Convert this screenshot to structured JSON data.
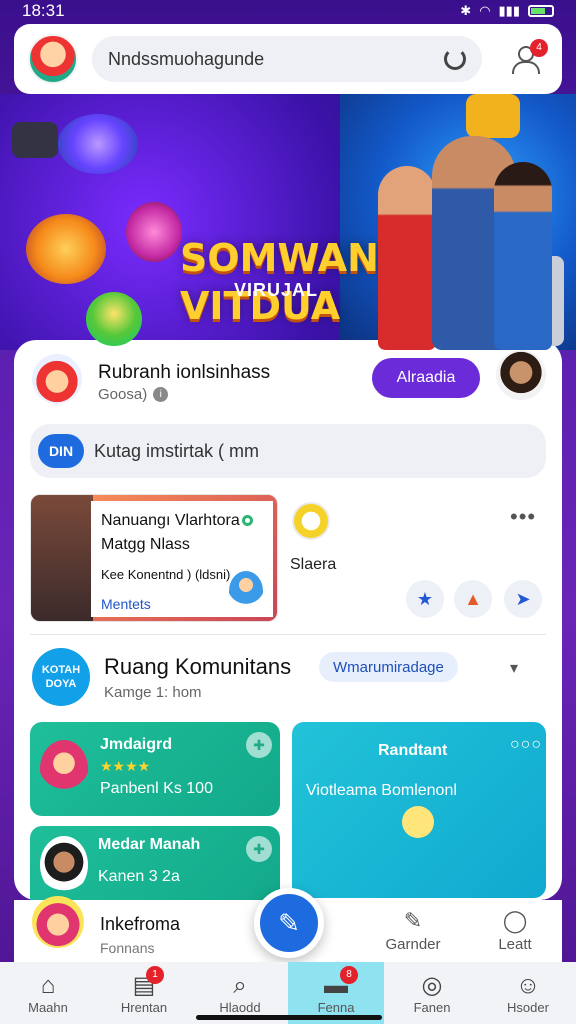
{
  "status": {
    "time": "18:31"
  },
  "header": {
    "search_text": "Nndssmuohagundе"
  },
  "notifications": {
    "count": "4"
  },
  "banner": {
    "title_line1": "SOMWAN",
    "title_line2": "VITDUA",
    "subtitle": "VIRUJAL"
  },
  "profile": {
    "name": "Rubranh ionlsinhass",
    "meta": "Goosa)",
    "primary_button": "Alraadia"
  },
  "chip": {
    "logo": "DIN",
    "text": "Kutag imstirtak ( mm"
  },
  "feature": {
    "line1": "Nanuangı Vlarhtora",
    "line2": "Matgg Nlass",
    "line3": "Kee Konentnd ) (ldsni)",
    "link": "Mentets",
    "side_label": "Slaera"
  },
  "community": {
    "logo": "KOTAH DOYA",
    "title": "Ruang Komunitans",
    "subtitle": "Kamge 1: hom",
    "tag": "Wmarumiradage"
  },
  "tiles": [
    {
      "title": "Jmdaigrd",
      "stars": "★★★★",
      "subtitle": "Panbenl Ks 100"
    },
    {
      "title": "Medar Manah",
      "subtitle": "Kanen 3 2a"
    },
    {
      "title": "Randtant",
      "subtitle": "Viotleama Bomlenonl"
    }
  ],
  "bottom_strip": {
    "title": "Inkefroma",
    "subtitle": "Fonnans",
    "actions": [
      "Garnder",
      "Leatt"
    ]
  },
  "tabbar": [
    {
      "label": "Maahn",
      "icon": "home-icon"
    },
    {
      "label": "Hrentan",
      "icon": "calendar-icon",
      "badge": "1"
    },
    {
      "label": "Hlaodd",
      "icon": "search-icon"
    },
    {
      "label": "Fenna",
      "icon": "chat-icon",
      "badge": "8"
    },
    {
      "label": "Fanen",
      "icon": "compass-icon"
    },
    {
      "label": "Hsoder",
      "icon": "profile-icon"
    }
  ],
  "colors": {
    "primary": "#6b2bd9",
    "accent": "#1e6be0",
    "teal": "#1fbf9a",
    "cyan": "#22c3d8"
  }
}
